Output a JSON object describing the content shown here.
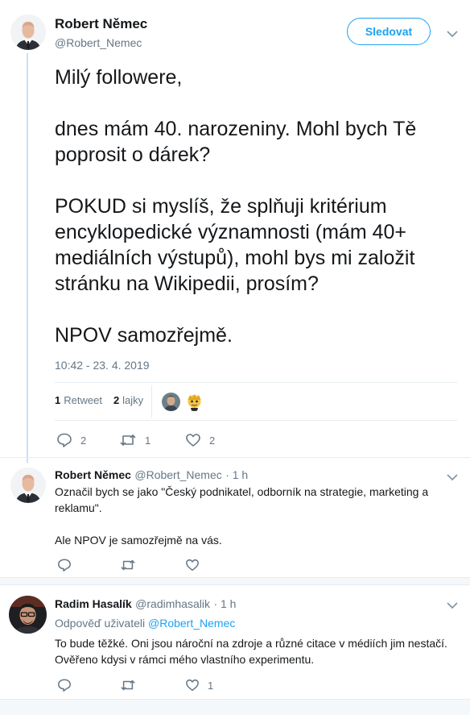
{
  "main_tweet": {
    "author_name": "Robert Němec",
    "author_handle": "@Robert_Nemec",
    "follow_label": "Sledovat",
    "text_lines": [
      "Milý followere,",
      "",
      "dnes mám 40. narozeniny. Mohl bych Tě",
      "poprosit o dárek?",
      "",
      "POKUD si myslíš, že splňuji kritérium",
      "encyklopedické významnosti (mám 40+",
      "mediálních výstupů), mohl bys mi založit",
      "stránku na Wikipedii, prosím?",
      "",
      "NPOV samozřejmě."
    ],
    "timestamp": "10:42 - 23. 4. 2019",
    "retweets_count": "1",
    "retweets_label": "Retweet",
    "likes_count": "2",
    "likes_label": "lajky",
    "reply_count": "2",
    "retweet_count": "1",
    "like_count": "2"
  },
  "replies": [
    {
      "author_name": "Robert Němec",
      "author_handle": "@Robert_Nemec",
      "time": "· 1 h",
      "lines": [
        "Označil bych se jako \"Český podnikatel, odborník na strategie, marketing a",
        "reklamu\".",
        "",
        "Ale NPOV je samozřejmě na vás."
      ],
      "reply_count": "",
      "retweet_count": "",
      "like_count": ""
    },
    {
      "author_name": "Radim Hasalík",
      "author_handle": "@radimhasalik",
      "time": "· 1 h",
      "reply_to_label": "Odpověď uživateli",
      "reply_to_handle": "@Robert_Nemec",
      "lines": [
        "To bude těžké. Oni jsou nároční na zdroje a různé citace v médiích jim nestačí.",
        "Ověřeno kdysi v rámci mého vlastního experimentu."
      ],
      "reply_count": "",
      "retweet_count": "",
      "like_count": "1"
    }
  ],
  "colors": {
    "accent": "#1da1f2",
    "muted": "#657786",
    "text": "#14171a",
    "thread_line": "#c4e2f6"
  },
  "icons": [
    "reply-icon",
    "retweet-icon",
    "like-icon",
    "chevron-down-icon"
  ]
}
